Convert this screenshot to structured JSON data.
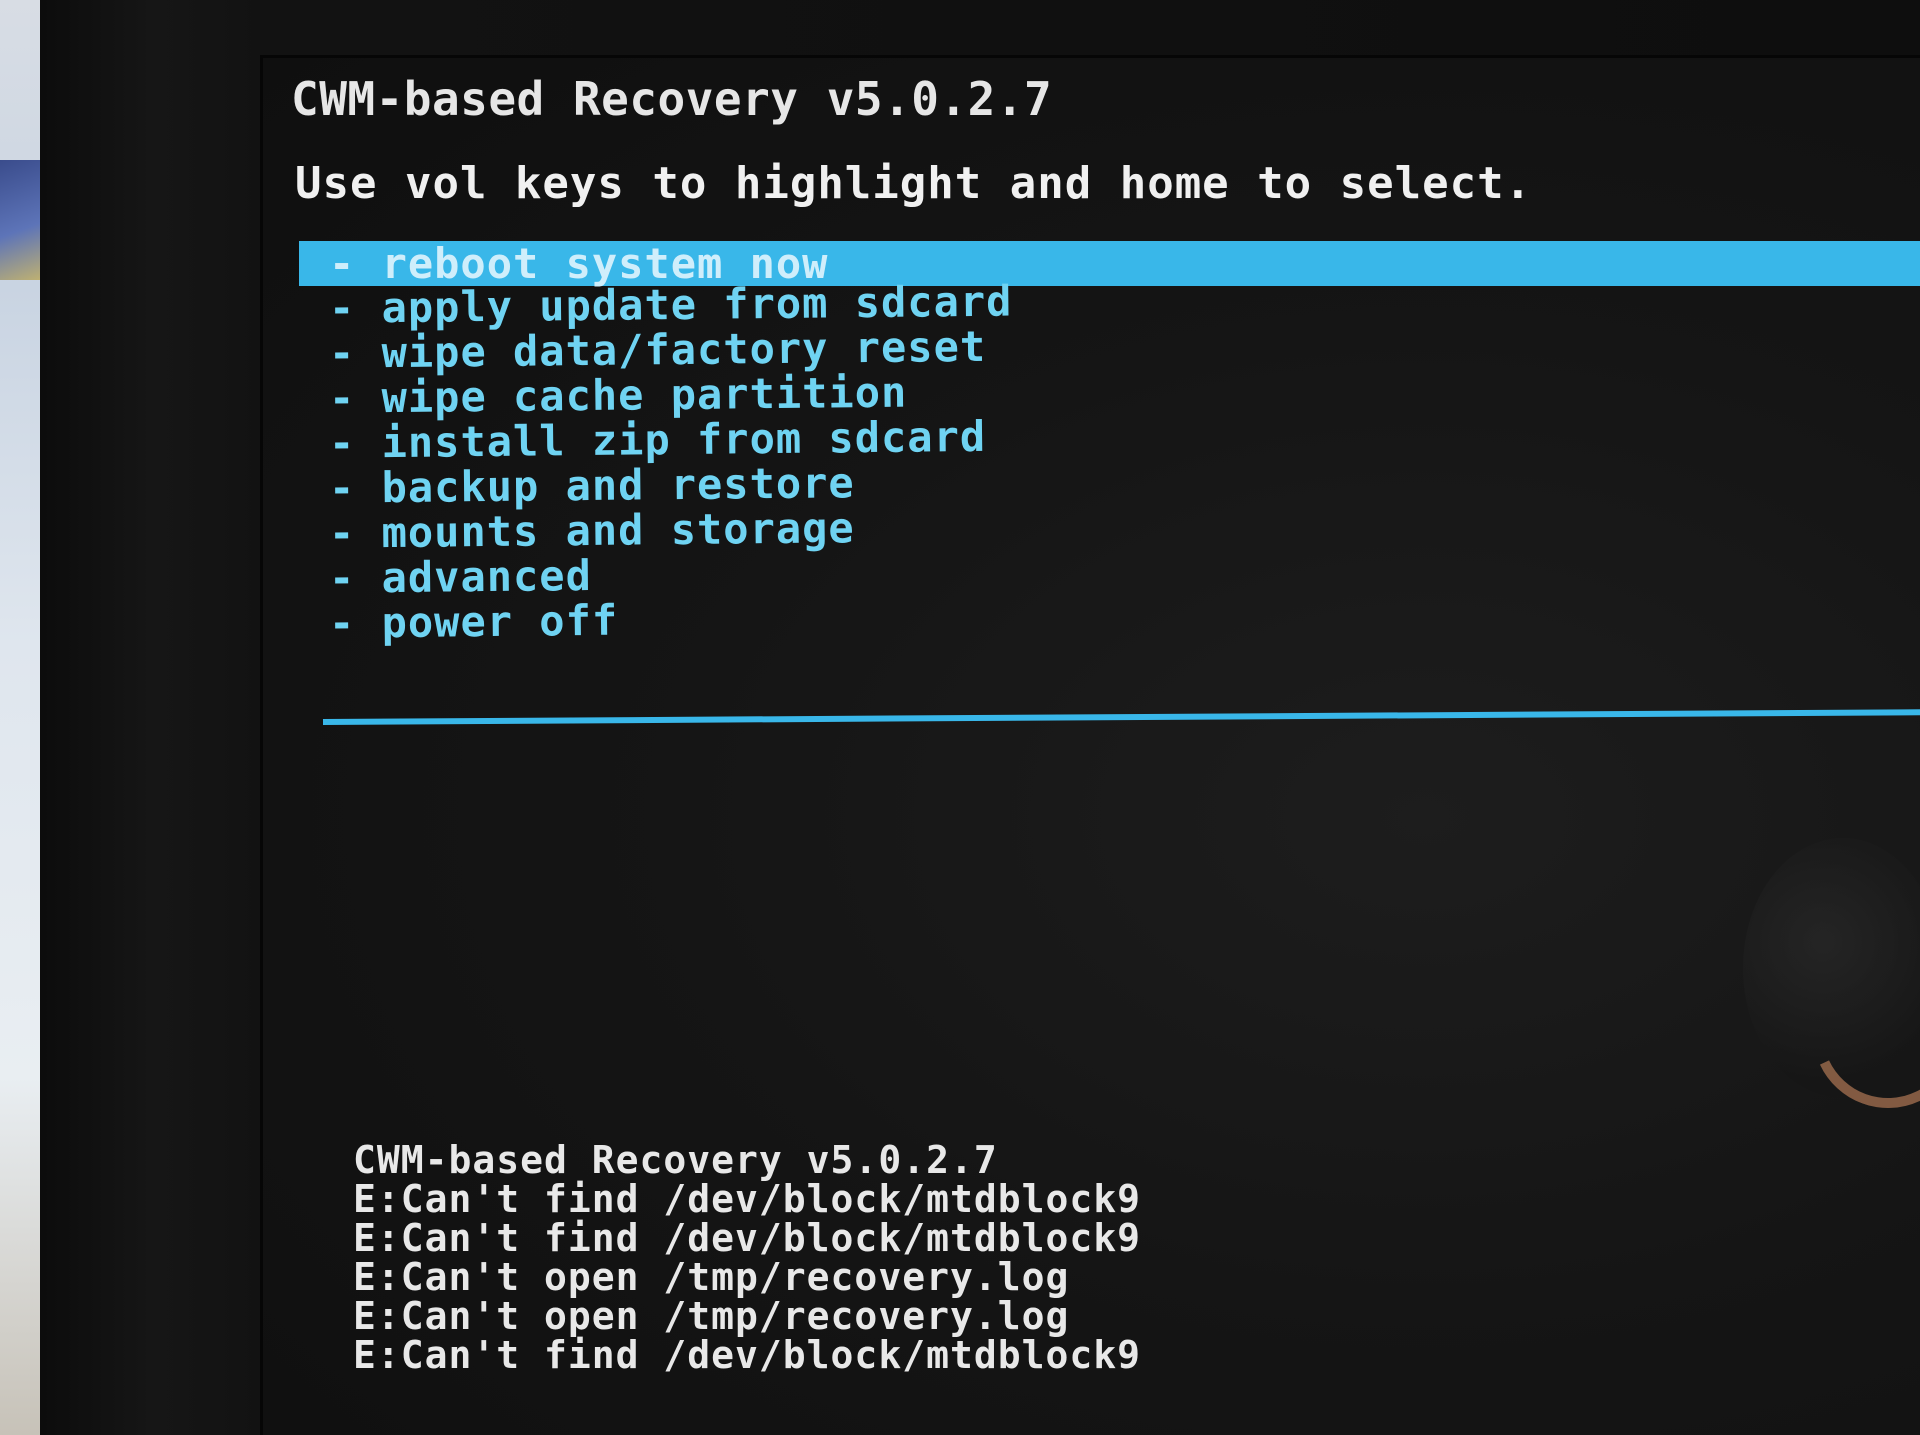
{
  "recovery": {
    "title": "CWM-based Recovery v5.0.2.7",
    "instruction": "Use vol keys to highlight and home to select.",
    "menu_items": [
      {
        "label": "- reboot system now",
        "selected": true
      },
      {
        "label": "- apply update from sdcard",
        "selected": false
      },
      {
        "label": "- wipe data/factory reset",
        "selected": false
      },
      {
        "label": "- wipe cache partition",
        "selected": false
      },
      {
        "label": "- install zip from sdcard",
        "selected": false
      },
      {
        "label": "- backup and restore",
        "selected": false
      },
      {
        "label": "- mounts and storage",
        "selected": false
      },
      {
        "label": "- advanced",
        "selected": false
      },
      {
        "label": "- power off",
        "selected": false
      }
    ],
    "log_lines": [
      "CWM-based Recovery v5.0.2.7",
      "E:Can't find /dev/block/mtdblock9",
      "E:Can't find /dev/block/mtdblock9",
      "E:Can't open /tmp/recovery.log",
      "E:Can't open /tmp/recovery.log",
      "E:Can't find /dev/block/mtdblock9"
    ]
  },
  "colors": {
    "highlight": "#39b7e9",
    "menu_text": "#6fd3f2",
    "text": "#f0f0f0",
    "background": "#151515"
  }
}
